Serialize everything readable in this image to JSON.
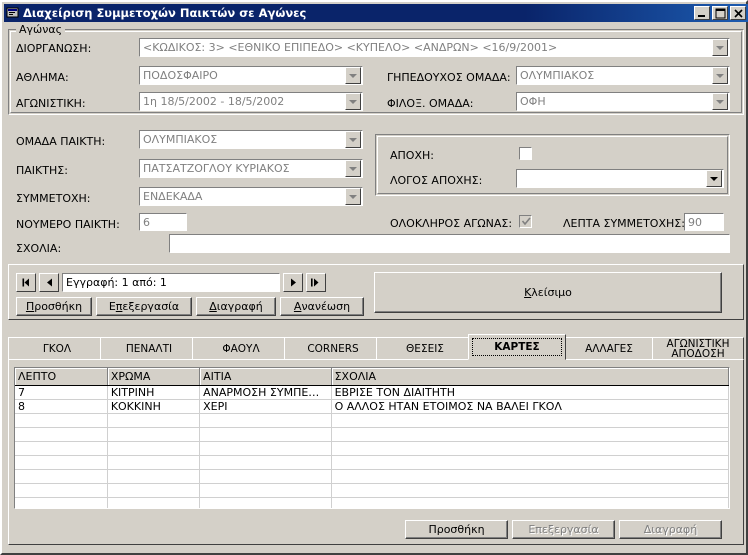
{
  "window": {
    "title": "Διαχείριση Συμμετοχών Παικτών σε Αγώνες",
    "icon": "form-icon",
    "minimize": "minimize-icon",
    "maximize": "maximize-icon",
    "close": "close-icon",
    "titlebar_color": "#0a246a",
    "face_color": "#d4d0c8"
  },
  "match_group": {
    "legend": "Αγώνας",
    "fields": {
      "organization_label": "ΔΙΟΡΓΑΝΩΣΗ:",
      "organization_value": "<ΚΩΔΙΚΟΣ:  3> <ΕΘΝΙΚΟ ΕΠΙΠΕΔΟ> <ΚΥΠΕΛΟ> <ΑΝΔΡΩΝ> <16/9/2001>",
      "sport_label": "ΑΘΛΗΜΑ:",
      "sport_value": "ΠΟΔΟΣΦΑΙΡΟ",
      "matchday_label": "ΑΓΩΝΙΣΤΙΚΗ:",
      "matchday_value": "1η  18/5/2002 - 18/5/2002",
      "home_team_label": "ΓΗΠΕΔΟΥΧΟΣ ΟΜΑΔΑ:",
      "home_team_value": "ΟΛΥΜΠΙΑΚΟΣ",
      "away_team_label": "ΦΙΛΟΞ. ΟΜΑΔΑ:",
      "away_team_value": "ΟΦΗ"
    }
  },
  "participation": {
    "player_team_label": "ΟΜΑΔΑ ΠΑΙΚΤΗ:",
    "player_team_value": "ΟΛΥΜΠΙΑΚΟΣ",
    "player_label": "ΠΑΙΚΤΗΣ:",
    "player_value": "ΠΑΤΣΑΤΖΟΓΛΟΥ ΚΥΡΙΑΚΟΣ",
    "participation_label": "ΣΥΜΜΕΤΟΧΗ:",
    "participation_value": "ΕΝΔΕΚΑΔΑ",
    "player_number_label": "ΝΟΥΜΕΡΟ ΠΑΙΚΤΗ:",
    "player_number_value": "6",
    "comments_label": "ΣΧΟΛΙΑ:",
    "comments_value": ""
  },
  "absence": {
    "absence_label": "ΑΠΟΧΗ:",
    "absence_checked": false,
    "absence_reason_label": "ΛΟΓΟΣ ΑΠΟΧΗΣ:",
    "absence_reason_value": "",
    "full_match_label": "ΟΛΟΚΛΗΡΟΣ ΑΓΩΝΑΣ:",
    "full_match_checked": true,
    "minutes_label": "ΛΕΠΤΑ ΣΥΜΜΕΤΟΧΗΣ:",
    "minutes_value": "90"
  },
  "navigator": {
    "first_icon": "first-record-icon",
    "prev_icon": "previous-record-icon",
    "next_icon": "next-record-icon",
    "last_icon": "last-record-icon",
    "position_text": "Εγγραφή: 1 από: 1",
    "buttons": [
      {
        "label": "Προσθήκη",
        "accel": "Π",
        "enabled": true
      },
      {
        "label": "Επεξεργασία",
        "accel": "π",
        "enabled": true
      },
      {
        "label": "Διαγραφή",
        "accel": "Δ",
        "enabled": true
      },
      {
        "label": "Ανανέωση",
        "accel": "Α",
        "enabled": true
      }
    ],
    "close_button": {
      "label": "Κλείσιμο",
      "accel": "Κ"
    }
  },
  "tabs": [
    {
      "label": "ΓΚΟΛ",
      "selected": false,
      "lines": [
        "ΓΚΟΛ"
      ]
    },
    {
      "label": "ΠΕΝΑΛΤΙ",
      "selected": false,
      "lines": [
        "ΠΕΝΑΛΤΙ"
      ]
    },
    {
      "label": "ΦΑΟΥΛ",
      "selected": false,
      "lines": [
        "ΦΑΟΥΛ"
      ]
    },
    {
      "label": "CORNERS",
      "selected": false,
      "lines": [
        "CORNERS"
      ]
    },
    {
      "label": "ΘΕΣΕΙΣ",
      "selected": false,
      "lines": [
        "ΘΕΣΕΙΣ"
      ]
    },
    {
      "label": "ΚΑΡΤΕΣ",
      "selected": true,
      "lines": [
        "ΚΑΡΤΕΣ"
      ]
    },
    {
      "label": "ΑΛΛΑΓΕΣ",
      "selected": false,
      "lines": [
        "ΑΛΛΑΓΕΣ"
      ]
    },
    {
      "label": "ΑΓΩΝΙΣΤΙΚΗ ΑΠΟΔΟΣΗ",
      "selected": false,
      "lines": [
        "ΑΓΩΝΙΣΤΙΚΗ",
        "ΑΠΟΔΟΣΗ"
      ]
    }
  ],
  "grid": {
    "columns": [
      "ΛΕΠΤΟ",
      "ΧΡΩΜΑ",
      "ΑΙΤΙΑ",
      "ΣΧΟΛΙΑ"
    ],
    "rows": [
      [
        "7",
        "ΚΙΤΡΙΝΗ",
        "ΑΝΑΡΜΟΣΗ ΣΥΜΠΕ…",
        "ΕΒΡΙΣΕ ΤΟΝ ΔΙΑΙΤΗΤΗ"
      ],
      [
        "8",
        "ΚΟΚΚΙΝΗ",
        "ΧΕΡΙ",
        "Ο ΑΛΛΟΣ ΗΤΑΝ ΕΤΟΙΜΟΣ ΝΑ ΒΑΛΕΙ ΓΚΟΛ"
      ]
    ],
    "empty_row_count": 9
  },
  "grid_actions": [
    {
      "label": "Προσθήκη",
      "enabled": true
    },
    {
      "label": "Επεξεργασία",
      "enabled": false
    },
    {
      "label": "Διαγραφή",
      "enabled": false
    }
  ]
}
